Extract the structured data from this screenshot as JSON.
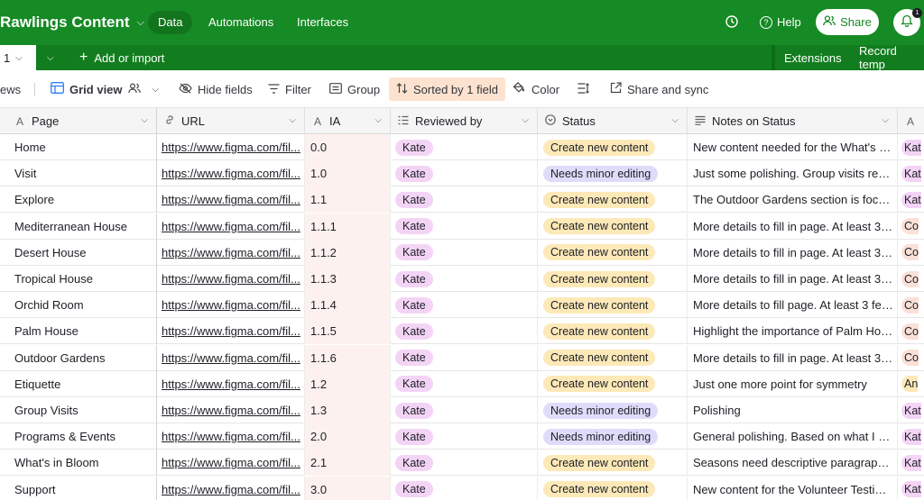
{
  "app": {
    "base_title": "Rawlings Content",
    "nav_tabs": [
      "Data",
      "Automations",
      "Interfaces"
    ],
    "help_label": "Help",
    "share_label": "Share",
    "notification_count": "1"
  },
  "tabbar": {
    "table_tab_label": "1",
    "add_label": "Add or import",
    "extensions_label": "Extensions",
    "record_label": "Record temp"
  },
  "viewbar": {
    "views_label": "ews",
    "grid_view_label": "Grid view",
    "hide_fields_label": "Hide fields",
    "filter_label": "Filter",
    "group_label": "Group",
    "sorted_label": "Sorted by 1 field",
    "color_label": "Color",
    "share_sync_label": "Share and sync"
  },
  "columns": {
    "page": "Page",
    "url": "URL",
    "ia": "IA",
    "reviewed_by": "Reviewed by",
    "status": "Status",
    "notes": "Notes on Status",
    "extra": "A"
  },
  "colors": {
    "topbar": "#168a24",
    "kate_pill": "#f4d4f6",
    "create_pill": "#fde9b8",
    "minor_pill": "#dfdcfb",
    "sorted_highlight": "#fde3cf"
  },
  "rows": [
    {
      "page": "Home",
      "url": "https://www.figma.com/fil...",
      "ia": "0.0",
      "reviewer": "Kate",
      "status": "Create new content",
      "status_type": "create",
      "notes": "New content needed for the What's in...",
      "extra": "Kat",
      "extra_type": "kate"
    },
    {
      "page": "Visit",
      "url": "https://www.figma.com/fil...",
      "ia": "1.0",
      "reviewer": "Kate",
      "status": "Needs minor editing",
      "status_type": "minor",
      "notes": "Just some polishing. Group visits read...",
      "extra": "Kat",
      "extra_type": "kate"
    },
    {
      "page": "Explore",
      "url": "https://www.figma.com/fil...",
      "ia": "1.1",
      "reviewer": "Kate",
      "status": "Create new content",
      "status_type": "create",
      "notes": "The Outdoor Gardens section is focus...",
      "extra": "Kat",
      "extra_type": "kate"
    },
    {
      "page": "Mediterranean House",
      "url": "https://www.figma.com/fil...",
      "ia": "1.1.1",
      "reviewer": "Kate",
      "status": "Create new content",
      "status_type": "create",
      "notes": "More details to fill in page. At least 3 f...",
      "extra": "Co",
      "extra_type": "co"
    },
    {
      "page": "Desert House",
      "url": "https://www.figma.com/fil...",
      "ia": "1.1.2",
      "reviewer": "Kate",
      "status": "Create new content",
      "status_type": "create",
      "notes": "More details to fill in page. At least 3 f...",
      "extra": "Co",
      "extra_type": "co"
    },
    {
      "page": "Tropical House",
      "url": "https://www.figma.com/fil...",
      "ia": "1.1.3",
      "reviewer": "Kate",
      "status": "Create new content",
      "status_type": "create",
      "notes": "More details to fill in page. At least 3 f...",
      "extra": "Co",
      "extra_type": "co"
    },
    {
      "page": "Orchid Room",
      "url": "https://www.figma.com/fil...",
      "ia": "1.1.4",
      "reviewer": "Kate",
      "status": "Create new content",
      "status_type": "create",
      "notes": "More details to fill page. At least 3 fea...",
      "extra": "Co",
      "extra_type": "co"
    },
    {
      "page": "Palm House",
      "url": "https://www.figma.com/fil...",
      "ia": "1.1.5",
      "reviewer": "Kate",
      "status": "Create new content",
      "status_type": "create",
      "notes": "Highlight the importance of Palm Hou...",
      "extra": "Co",
      "extra_type": "co"
    },
    {
      "page": "Outdoor Gardens",
      "url": "https://www.figma.com/fil...",
      "ia": "1.1.6",
      "reviewer": "Kate",
      "status": "Create new content",
      "status_type": "create",
      "notes": "More details to fill in page. At least 3 f...",
      "extra": "Co",
      "extra_type": "co"
    },
    {
      "page": "Etiquette",
      "url": "https://www.figma.com/fil...",
      "ia": "1.2",
      "reviewer": "Kate",
      "status": "Create new content",
      "status_type": "create",
      "notes": "Just one more point for symmetry",
      "extra": "An",
      "extra_type": "an"
    },
    {
      "page": "Group Visits",
      "url": "https://www.figma.com/fil...",
      "ia": "1.3",
      "reviewer": "Kate",
      "status": "Needs minor editing",
      "status_type": "minor",
      "notes": "Polishing",
      "extra": "Kat",
      "extra_type": "kate"
    },
    {
      "page": "Programs & Events",
      "url": "https://www.figma.com/fil...",
      "ia": "2.0",
      "reviewer": "Kate",
      "status": "Needs minor editing",
      "status_type": "minor",
      "notes": "General polishing. Based on what I kn...",
      "extra": "Kat",
      "extra_type": "kate"
    },
    {
      "page": "What's in Bloom",
      "url": "https://www.figma.com/fil...",
      "ia": "2.1",
      "reviewer": "Kate",
      "status": "Create new content",
      "status_type": "create",
      "notes": "Seasons need descriptive paragraph ...",
      "extra": "Kat",
      "extra_type": "kate"
    },
    {
      "page": "Support",
      "url": "https://www.figma.com/fil...",
      "ia": "3.0",
      "reviewer": "Kate",
      "status": "Create new content",
      "status_type": "create",
      "notes": "New content for the Volunteer Testim...",
      "extra": "Kat",
      "extra_type": "kate"
    }
  ]
}
